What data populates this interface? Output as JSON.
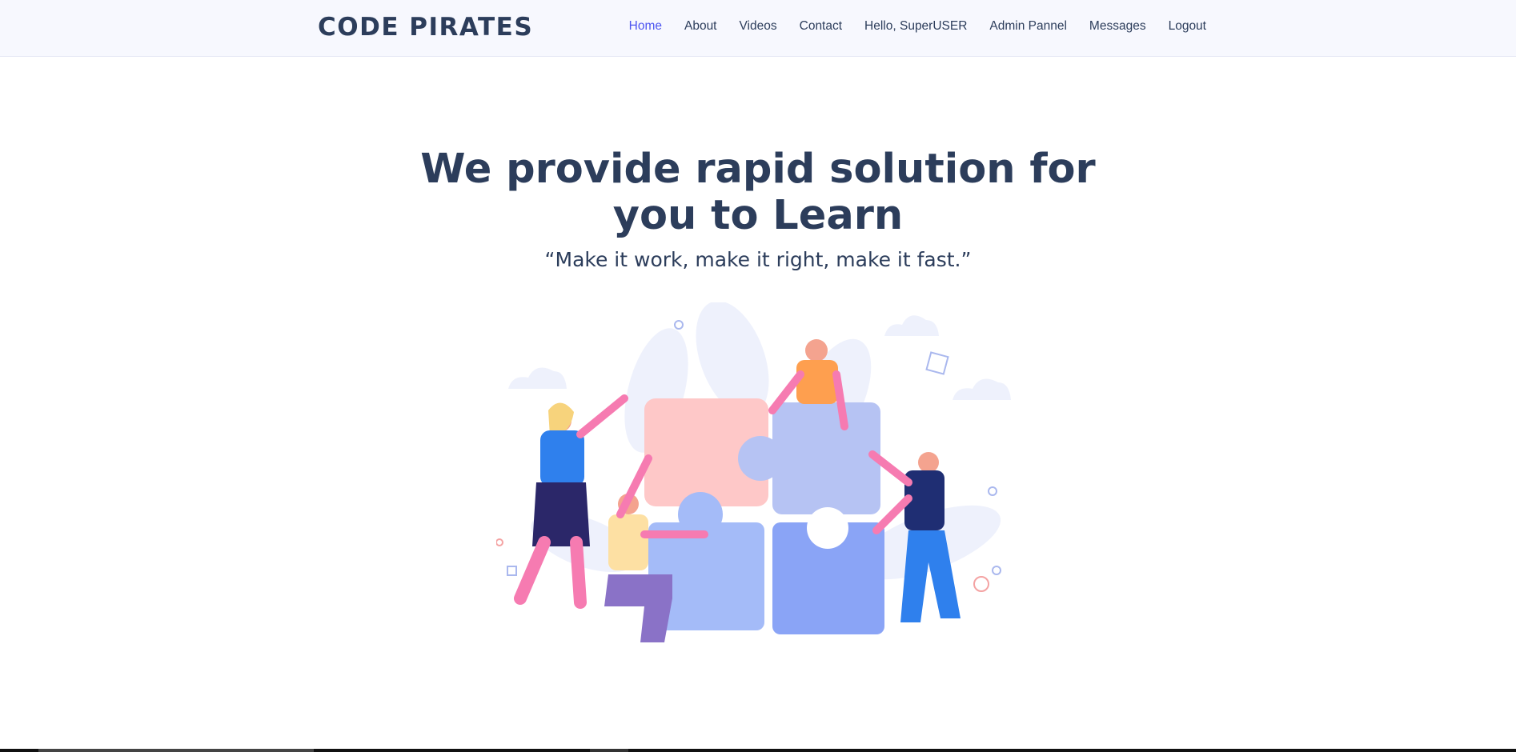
{
  "navbar": {
    "brand": "CODE PIRATES",
    "items": [
      {
        "label": "Home",
        "active": true
      },
      {
        "label": "About"
      },
      {
        "label": "Videos"
      },
      {
        "label": "Contact"
      },
      {
        "label": "Hello, SuperUSER"
      },
      {
        "label": "Admin Pannel"
      },
      {
        "label": "Messages"
      },
      {
        "label": "Logout"
      }
    ],
    "active_color": "#4d55f0",
    "text_color": "#2c3d5b"
  },
  "hero": {
    "title_line1": "We provide rapid solution for",
    "title_line2": "you to Learn",
    "quote": "“Make it work, make it right, make it fast.”",
    "illustration": "people-assembling-puzzle-illustration"
  }
}
